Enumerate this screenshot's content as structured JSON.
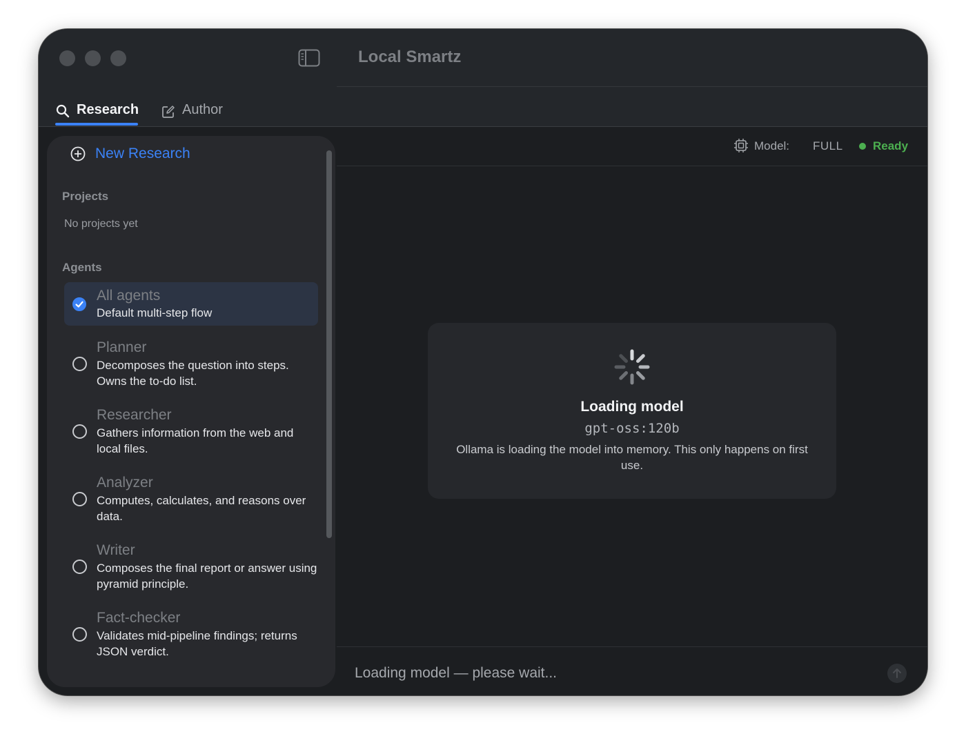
{
  "window": {
    "title": "Local Smartz"
  },
  "tabs": [
    {
      "label": "Research",
      "icon": "search-icon",
      "active": true
    },
    {
      "label": "Author",
      "icon": "compose-icon",
      "active": false
    }
  ],
  "sidebar": {
    "new_research_label": "New Research",
    "projects_label": "Projects",
    "projects_empty": "No projects yet",
    "agents_label": "Agents",
    "agents": [
      {
        "name": "All agents",
        "description": "Default multi-step flow",
        "selected": true
      },
      {
        "name": "Planner",
        "description": "Decomposes the question into steps. Owns the to-do list.",
        "selected": false
      },
      {
        "name": "Researcher",
        "description": "Gathers information from the web and local files.",
        "selected": false
      },
      {
        "name": "Analyzer",
        "description": "Computes, calculates, and reasons over data.",
        "selected": false
      },
      {
        "name": "Writer",
        "description": "Composes the final report or answer using pyramid principle.",
        "selected": false
      },
      {
        "name": "Fact-checker",
        "description": "Validates mid-pipeline findings; returns JSON verdict.",
        "selected": false
      }
    ]
  },
  "status": {
    "model_label": "Model:",
    "model_value": "FULL",
    "state": "Ready",
    "state_color": "#4caf50"
  },
  "loading": {
    "title": "Loading model",
    "model": "gpt-oss:120b",
    "description": "Ollama is loading the model into memory. This only happens on first use."
  },
  "composer": {
    "placeholder": "Loading model — please wait..."
  },
  "colors": {
    "accent": "#3b82f6",
    "background": "#1c1e21",
    "sidebar": "#28292d"
  }
}
